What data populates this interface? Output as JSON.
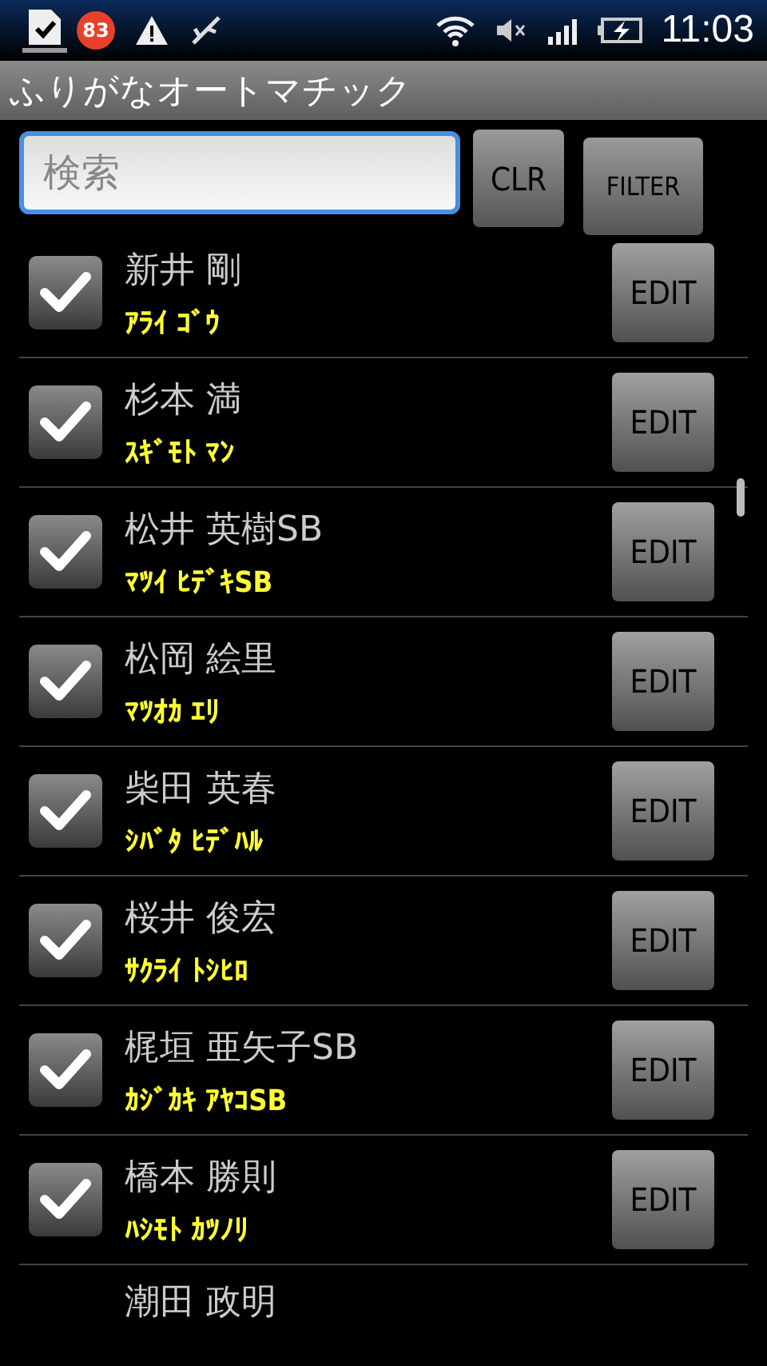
{
  "status_bar": {
    "badge": "83",
    "time": "11:03"
  },
  "window": {
    "title": "ふりがなオートマチック"
  },
  "search": {
    "placeholder": "検索",
    "clear_button": "CLR",
    "filter_button": "FILTER"
  },
  "rows": [
    {
      "name": "新井 剛",
      "reading": "ｱﾗｲ ｺﾞｳ",
      "checked": true,
      "button": "EDIT"
    },
    {
      "name": "杉本 満",
      "reading": "ｽｷﾞﾓﾄ ﾏﾝ",
      "checked": true,
      "button": "EDIT"
    },
    {
      "name": "松井 英樹SB",
      "reading": "ﾏﾂｲ ﾋﾃﾞｷSB",
      "checked": true,
      "button": "EDIT"
    },
    {
      "name": "松岡 絵里",
      "reading": "ﾏﾂｵｶ ｴﾘ",
      "checked": true,
      "button": "EDIT"
    },
    {
      "name": "柴田 英春",
      "reading": "ｼﾊﾞﾀ ﾋﾃﾞﾊﾙ",
      "checked": true,
      "button": "EDIT"
    },
    {
      "name": "桜井 俊宏",
      "reading": "ｻｸﾗｲ ﾄｼﾋﾛ",
      "checked": true,
      "button": "EDIT"
    },
    {
      "name": "梶垣 亜矢子SB",
      "reading": "ｶｼﾞｶｷ ｱﾔｺSB",
      "checked": true,
      "button": "EDIT"
    },
    {
      "name": "橋本 勝則",
      "reading": "ﾊｼﾓﾄ ｶﾂﾉﾘ",
      "checked": true,
      "button": "EDIT"
    },
    {
      "name": "潮田 政明"
    }
  ]
}
